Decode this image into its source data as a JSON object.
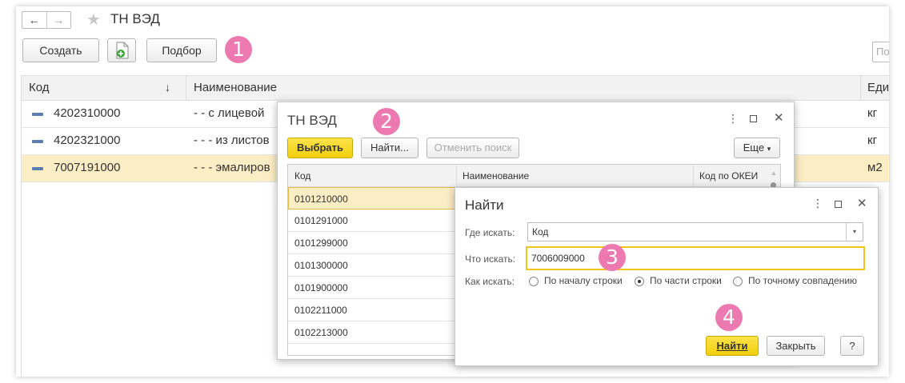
{
  "main": {
    "title": "ТН ВЭД",
    "nav_back": "←",
    "nav_forward": "→",
    "star": "★",
    "create_label": "Создать",
    "pick_label": "Подбор",
    "search_placeholder": "По",
    "callout1": "1",
    "columns": [
      "Код",
      "Наименование",
      "Еди"
    ],
    "sort_arrow": "↓",
    "rows": [
      {
        "code": "4202310000",
        "name": "- - с лицевой",
        "unit": "кг"
      },
      {
        "code": "4202321000",
        "name": "- - - из листов",
        "unit": "кг"
      },
      {
        "code": "7007191000",
        "name": "- - - эмалиров",
        "unit": "м2"
      }
    ]
  },
  "dialog1": {
    "title": "ТН ВЭД",
    "callout": "2",
    "select_label": "Выбрать",
    "find_label": "Найти...",
    "cancel_search_label": "Отменить поиск",
    "more_label": "Еще",
    "columns": [
      "Код",
      "Наименование",
      "Код по ОКЕИ"
    ],
    "rows": [
      "0101210000",
      "0101291000",
      "0101299000",
      "0101300000",
      "0101900000",
      "0102211000",
      "0102213000"
    ]
  },
  "dialog2": {
    "title": "Найти",
    "where_label": "Где искать:",
    "where_value": "Код",
    "what_label": "Что искать:",
    "what_value": "7006009000",
    "callout3": "3",
    "how_label": "Как искать:",
    "options": [
      "По началу строки",
      "По части строки",
      "По точному совпадению"
    ],
    "selected_option": "По части строки",
    "callout4": "4",
    "find_label": "Найти",
    "close_label": "Закрыть",
    "help_label": "?"
  },
  "colors": {
    "accent_yellow": "#f5d214",
    "selection": "#fbedc4",
    "callout": "#ec7ab0"
  }
}
